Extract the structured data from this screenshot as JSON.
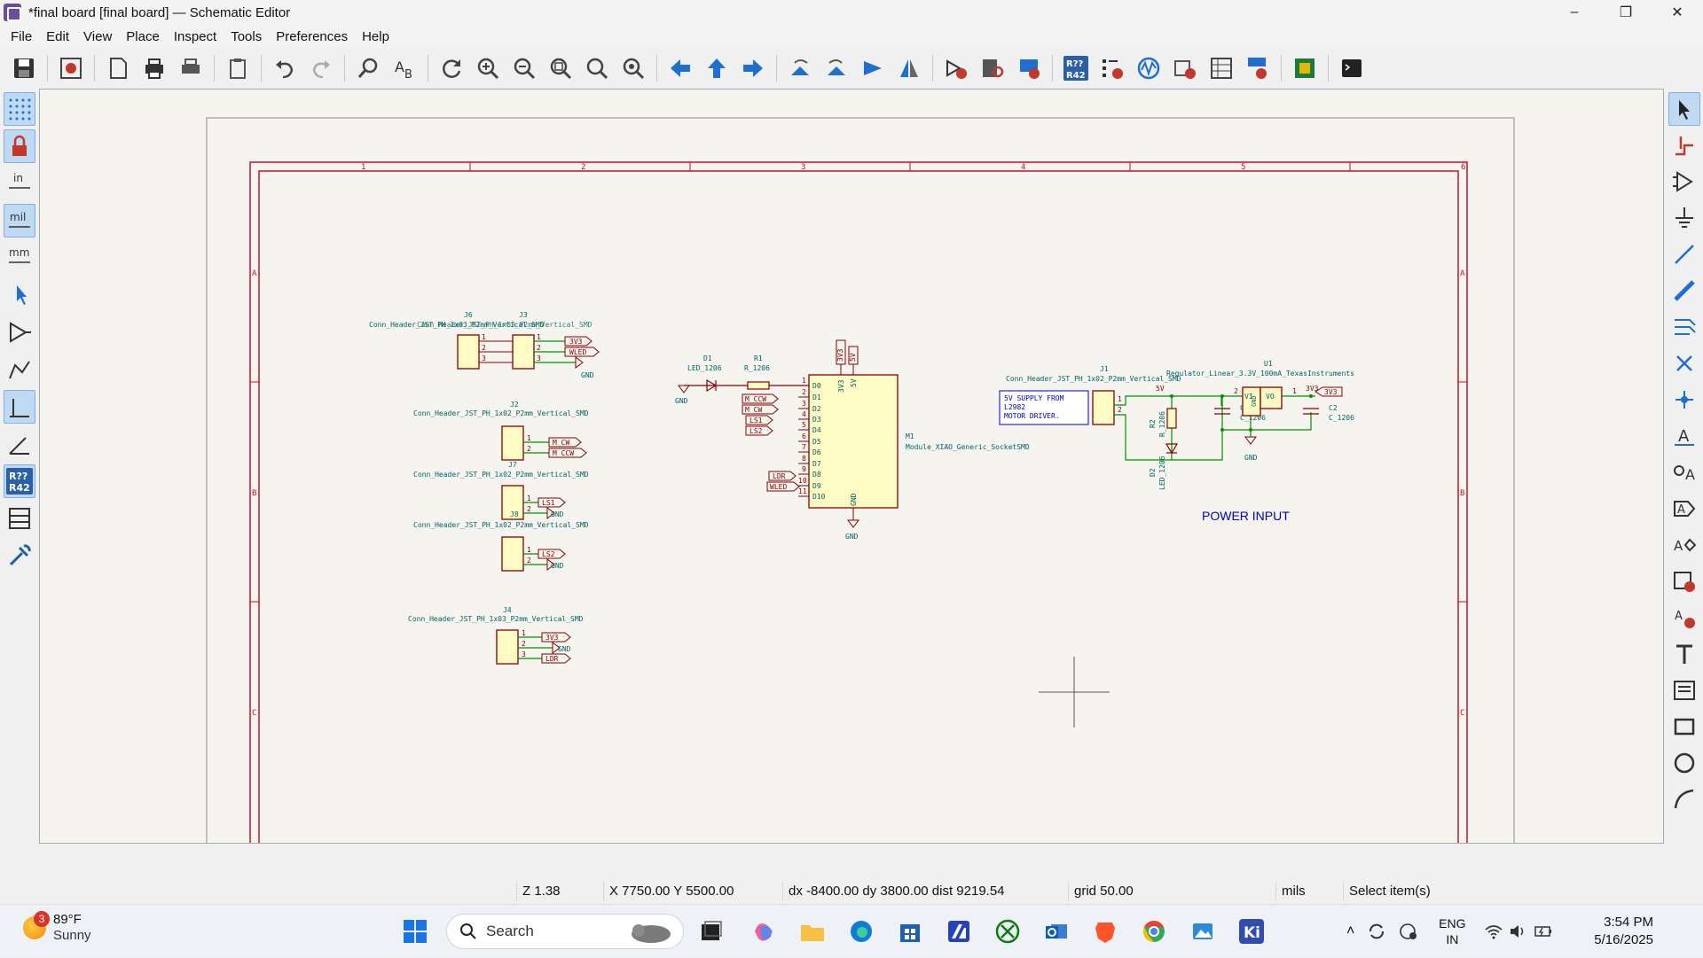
{
  "window": {
    "title": "*final board [final board] — Schematic Editor",
    "controls": {
      "minimize": "–",
      "restore": "❐",
      "close": "✕"
    }
  },
  "menu": [
    "File",
    "Edit",
    "View",
    "Place",
    "Inspect",
    "Tools",
    "Preferences",
    "Help"
  ],
  "toolbar_icons": [
    "save-icon",
    "schematic-setup-icon",
    "page-settings-icon",
    "print-icon",
    "plot-icon",
    "paste-icon",
    "undo-icon",
    "redo-icon",
    "find-icon",
    "find-replace-icon",
    "refresh-icon",
    "zoom-in-icon",
    "zoom-out-icon",
    "zoom-fit-icon",
    "zoom-objects-icon",
    "zoom-selection-icon",
    "navigate-back-icon",
    "navigate-up-icon",
    "navigate-forward-icon",
    "rotate-ccw-icon",
    "rotate-cw-icon",
    "mirror-horizontal-icon",
    "mirror-vertical-icon",
    "symbol-editor-icon",
    "symbol-browser-icon",
    "footprint-editor-icon",
    "annotate-icon",
    "erc-icon",
    "simulator-icon",
    "edit-fields-icon",
    "bom-icon",
    "generate-bom-icon",
    "pcb-editor-icon",
    "scripting-console-icon"
  ],
  "left_toolbar": {
    "unit_in": "in",
    "unit_mil": "mil",
    "unit_mm": "mm",
    "annotate_top": "R??",
    "annotate_bottom": "R42"
  },
  "toolbar_annotate": {
    "top": "R??",
    "bottom": "R42"
  },
  "schematic": {
    "border_columns": [
      "1",
      "2",
      "3",
      "4",
      "5",
      "6"
    ],
    "border_rows": [
      "A",
      "B",
      "C"
    ],
    "components": {
      "J6": {
        "ref": "J6",
        "value": "Conn_Header_JST_PH_1x03_P2mm_Vertical_SMD"
      },
      "J3": {
        "ref": "J3",
        "value": "Conn_Header_JST_PH_1x03_P2mm_Vertical_SMD"
      },
      "J2": {
        "ref": "J2",
        "value": "Conn_Header_JST_PH_1x02_P2mm_Vertical_SMD"
      },
      "J7": {
        "ref": "J7",
        "value": "Conn_Header_JST_PH_1x02_P2mm_Vertical_SMD"
      },
      "J8": {
        "ref": "J8",
        "value": "Conn_Header_JST_PH_1x02_P2mm_Vertical_SMD"
      },
      "J4": {
        "ref": "J4",
        "value": "Conn_Header_JST_PH_1x03_P2mm_Vertical_SMD"
      },
      "D1": {
        "ref": "D1",
        "value": "LED_1206"
      },
      "R1": {
        "ref": "R1",
        "value": "R_1206"
      },
      "M1": {
        "ref": "M1",
        "value": "Module_XIAO_Generic_SocketSMD"
      },
      "J1": {
        "ref": "J1",
        "value": "Conn_Header_JST_PH_1x02_P2mm_Vertical_SMD"
      },
      "U1": {
        "ref": "U1",
        "value": "Regulator_Linear_3.3V_100mA_TexasInstruments"
      },
      "R2": {
        "ref": "R2",
        "value": "R_1206"
      },
      "D2": {
        "ref": "D2",
        "value": "LED_1206"
      },
      "C1": {
        "ref": "C1",
        "value": "C_1206"
      },
      "C2": {
        "ref": "C2",
        "value": "C_1206"
      }
    },
    "labels": {
      "3v3": "3V3",
      "5v": "5V",
      "gnd": "GND",
      "wled": "WLED",
      "m_cw": "M_CW",
      "m_ccw": "M_CCW",
      "ls1": "LS1",
      "ls2": "LS2",
      "ldr": "LDR"
    },
    "xiao_pins_left": [
      "D0",
      "D1",
      "D2",
      "D3",
      "D4",
      "D5",
      "D6",
      "D7",
      "D8",
      "D9",
      "D10"
    ],
    "xiao_pin_numbers": [
      "1",
      "2",
      "3",
      "4",
      "5",
      "6",
      "7",
      "8",
      "9",
      "10",
      "11"
    ],
    "regulator_pins": {
      "vi": "VI",
      "vo": "VO",
      "gnd": "GND"
    },
    "note_box": [
      "5V SUPPLY FROM",
      "L2982",
      "MOTOR DRIVER."
    ],
    "power_title": "POWER INPUT"
  },
  "status": {
    "zoom": "Z 1.38",
    "cursor": "X 7750.00  Y 5500.00",
    "delta": "dx -8400.00  dy 3800.00  dist 9219.54",
    "grid": "grid 50.00",
    "units": "mils",
    "mode": "Select item(s)"
  },
  "taskbar": {
    "weather_temp": "89°F",
    "weather_cond": "Sunny",
    "weather_badge": "3",
    "search_placeholder": "Search",
    "lang_top": "ENG",
    "lang_bottom": "IN",
    "time": "3:54 PM",
    "date": "5/16/2025"
  },
  "colors": {
    "sheet_border": "#c8102e",
    "component_body": "#fffbc4",
    "component_outline": "#840000",
    "wire": "#009000",
    "text_blue": "#006464",
    "label": "#840000",
    "power_title": "#0000c2"
  }
}
